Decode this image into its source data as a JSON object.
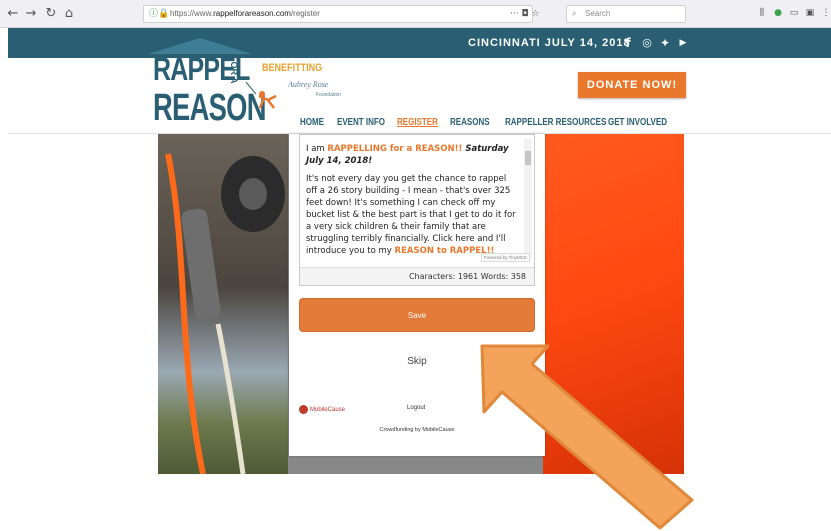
{
  "browser": {
    "url_prefix": "https://www.",
    "url_domain": "rappelforareason.com",
    "url_path": "/register",
    "search_placeholder": "Search",
    "icons": [
      "back-icon",
      "forward-icon",
      "reload-icon",
      "home-icon",
      "lock-icon",
      "page-actions-icon",
      "bookmark-star-icon",
      "library-icon",
      "extension-icon",
      "sidebar-icon",
      "menu-icon"
    ]
  },
  "site": {
    "event_line": "CINCINNATI JULY 14, 2018",
    "social": [
      {
        "name": "facebook-icon",
        "glyph": "f"
      },
      {
        "name": "instagram-icon",
        "glyph": "◎"
      },
      {
        "name": "twitter-icon",
        "glyph": "✦"
      },
      {
        "name": "youtube-icon",
        "glyph": "▶"
      }
    ],
    "logo_line1": "RAPPEL",
    "logo_line2": "REASON",
    "logo_fora": "FOR A",
    "benefitting": "BENEFITTING",
    "partner": "Aubrey Rose",
    "partner_sub": "Foundation",
    "donate_label": "DONATE NOW!",
    "nav": [
      {
        "label": "HOME",
        "active": false
      },
      {
        "label": "EVENT INFO",
        "active": false
      },
      {
        "label": "REGISTER",
        "active": true
      },
      {
        "label": "REASONS",
        "active": false
      },
      {
        "label": "RAPPELLER RESOURCES",
        "active": false
      },
      {
        "label": "GET INVOLVED",
        "active": false
      }
    ],
    "colors": {
      "brand": "#2a5f73",
      "accent": "#e9782d"
    }
  },
  "form": {
    "text_intro_a": "I am ",
    "text_intro_hl": "RAPPELLING for a REASON!!",
    "text_intro_b": " Saturday July 14, 2018!",
    "text_body": "It's not every day you get the chance to rappel off a 26 story building - I mean - that's over 325 feet down! It's something I can check off my bucket list & the best part is that I get to do it for a very sick children & their family that are struggling terribly financially.  Click here and I'll introduce you to my ",
    "text_link": "REASON to RAPPEL!!",
    "powered_by": "Powered by TinyMCE",
    "status": "Characters: 1961  Words: 358",
    "save_label": "Save",
    "skip_label": "Skip",
    "mc_logo": "MobileCause",
    "logout_label": "Logout",
    "footer": "Crowdfunding by MobileCause"
  }
}
